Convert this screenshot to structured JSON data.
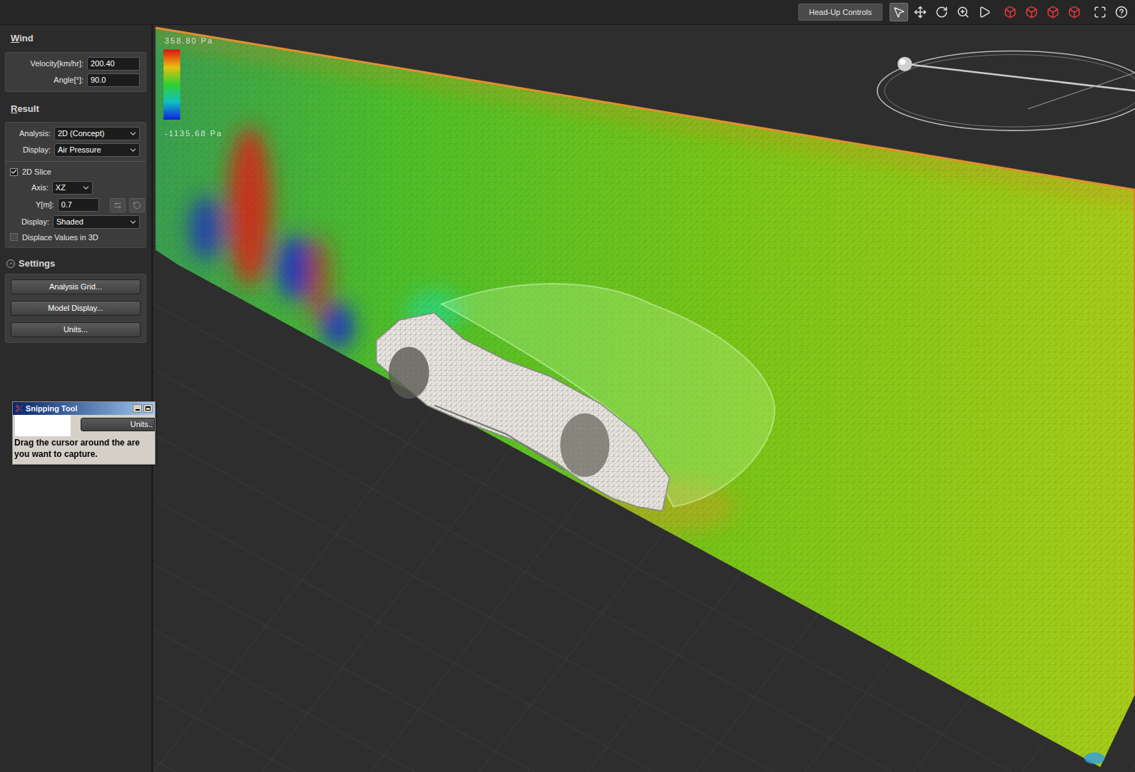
{
  "toolbar": {
    "button": "Head-Up Controls",
    "tools": [
      {
        "selected": true
      },
      {
        "selected": false
      },
      {
        "selected": false
      },
      {
        "selected": false
      },
      {
        "selected": false
      },
      {
        "selected": false
      },
      {
        "selected": false
      },
      {
        "selected": false
      },
      {
        "selected": false
      },
      {
        "selected": false
      },
      {
        "selected": false
      }
    ]
  },
  "wind": {
    "title": "Wind",
    "fields": [
      {
        "label": "Velocity[km/hr]:",
        "value": "200.40"
      },
      {
        "label": "Angle[°]:",
        "value": "90.0"
      }
    ]
  },
  "result": {
    "title": "Result",
    "selects": [
      {
        "label": "Analysis:",
        "value": "2D (Concept)"
      },
      {
        "label": "Display:",
        "value": "Air Pressure"
      }
    ],
    "slice": {
      "label": "2D Slice",
      "checked": true
    },
    "axis": {
      "label": "Axis:",
      "value": "XZ"
    },
    "position": {
      "label": "Y[m]:",
      "value": "0.7"
    },
    "display": {
      "label": "Display:",
      "value": "Shaded"
    },
    "displace": {
      "label": "Displace Values in 3D",
      "checked": false
    }
  },
  "settings": {
    "title": "Settings",
    "expanded": true,
    "buttons": [
      "Analysis Grid...",
      "Model Display...",
      "Units..."
    ]
  },
  "legend": {
    "max": "358.80 Pa",
    "min": "-1135.68 Pa"
  },
  "snipping_tool": {
    "title": "Snipping Tool",
    "button": "Units..",
    "message": [
      "Drag the cursor around the are",
      "you want to capture."
    ]
  }
}
